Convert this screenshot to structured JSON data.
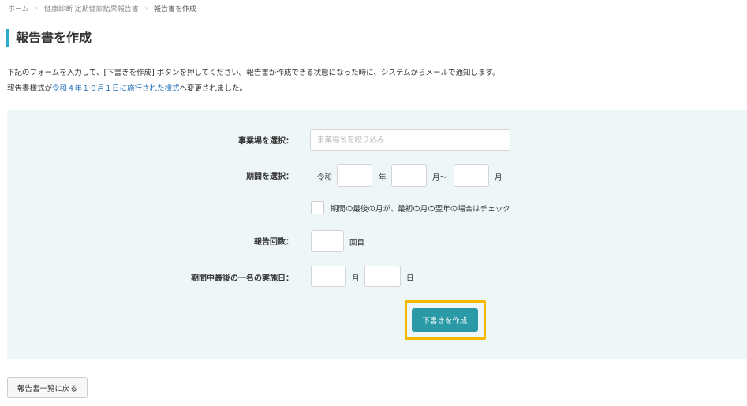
{
  "breadcrumb": {
    "home": "ホーム",
    "parent": "健康診断 定期健診結果報告書",
    "current": "報告書を作成",
    "separator": "›"
  },
  "page": {
    "title": "報告書を作成"
  },
  "description": {
    "line1": "下記のフォームを入力して、[下書きを作成] ボタンを押してください。報告書が作成できる状態になった時に、システムからメールで通知します。",
    "line2_prefix": "報告書様式が",
    "line2_link": "令和４年１０月１日に施行された様式",
    "line2_suffix": "へ変更されました。"
  },
  "form": {
    "facility": {
      "label": "事業場を選択：",
      "placeholder": "事業場名を絞り込み",
      "value": ""
    },
    "period": {
      "label": "期間を選択：",
      "era": "令和",
      "year_unit": "年",
      "year_value": "",
      "start_month_unit": "月〜",
      "start_month_value": "",
      "end_month_unit": "月",
      "end_month_value": ""
    },
    "next_year_check": {
      "label": "期間の最後の月が、最初の月の翌年の場合はチェック",
      "checked": false
    },
    "report_count": {
      "label": "報告回数：",
      "unit": "回目",
      "value": ""
    },
    "last_exam_date": {
      "label": "期間中最後の一名の実施日：",
      "month_unit": "月",
      "month_value": "",
      "day_unit": "日",
      "day_value": ""
    },
    "submit_label": "下書きを作成"
  },
  "footer": {
    "back_label": "報告書一覧に戻る"
  },
  "colors": {
    "accent": "#2aa9c9",
    "primary_button": "#2a9aa6",
    "highlight": "#f5b800",
    "panel_background": "#eef6f8",
    "link": "#1f6fb8"
  }
}
